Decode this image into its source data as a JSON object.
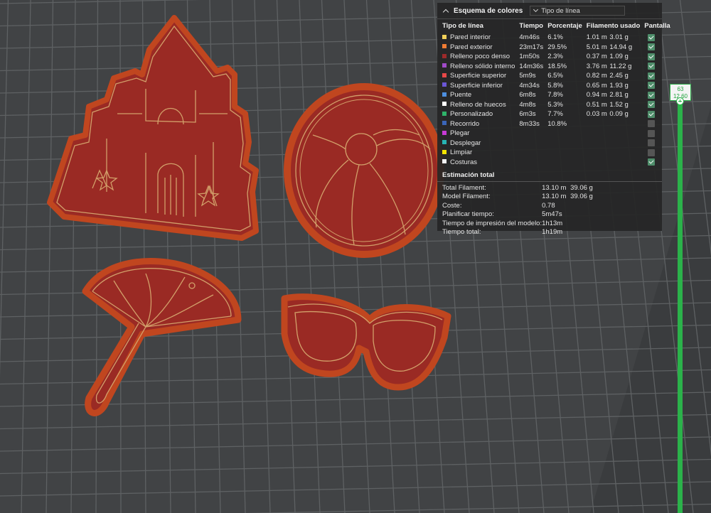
{
  "legend": {
    "title": "Esquema de colores",
    "view_mode": "Tipo de línea",
    "columns": [
      "Tipo de línea",
      "Tiempo",
      "Porcentaje",
      "Filamento usado",
      "Pantalla"
    ],
    "rows": [
      {
        "name": "Pared interior",
        "color": "#f2d15a",
        "time": "4m46s",
        "pct": "6.1%",
        "length": "1.01 m",
        "weight": "3.01 g",
        "display": true
      },
      {
        "name": "Pared exterior",
        "color": "#f07c34",
        "time": "23m17s",
        "pct": "29.5%",
        "length": "5.01 m",
        "weight": "14.94 g",
        "display": true
      },
      {
        "name": "Relleno poco denso",
        "color": "#9c2a2a",
        "time": "1m50s",
        "pct": "2.3%",
        "length": "0.37 m",
        "weight": "1.09 g",
        "display": true
      },
      {
        "name": "Relleno sólido interno",
        "color": "#a14bc9",
        "time": "14m36s",
        "pct": "18.5%",
        "length": "3.76 m",
        "weight": "11.22 g",
        "display": true
      },
      {
        "name": "Superficie superior",
        "color": "#e84848",
        "time": "5m9s",
        "pct": "6.5%",
        "length": "0.82 m",
        "weight": "2.45 g",
        "display": true
      },
      {
        "name": "Superficie inferior",
        "color": "#6b57d6",
        "time": "4m34s",
        "pct": "5.8%",
        "length": "0.65 m",
        "weight": "1.93 g",
        "display": true
      },
      {
        "name": "Puente",
        "color": "#4d8fe0",
        "time": "6m8s",
        "pct": "7.8%",
        "length": "0.94 m",
        "weight": "2.81 g",
        "display": true
      },
      {
        "name": "Relleno de huecos",
        "color": "#ffffff",
        "time": "4m8s",
        "pct": "5.3%",
        "length": "0.51 m",
        "weight": "1.52 g",
        "display": true
      },
      {
        "name": "Personalizado",
        "color": "#2fb36a",
        "time": "6m3s",
        "pct": "7.7%",
        "length": "0.03 m",
        "weight": "0.09 g",
        "display": true
      },
      {
        "name": "Recorrido",
        "color": "#3a66b8",
        "time": "8m33s",
        "pct": "10.8%",
        "length": "",
        "weight": "",
        "display": false
      },
      {
        "name": "Plegar",
        "color": "#c73ad6",
        "time": "",
        "pct": "",
        "length": "",
        "weight": "",
        "display": false
      },
      {
        "name": "Desplegar",
        "color": "#27b4b4",
        "time": "",
        "pct": "",
        "length": "",
        "weight": "",
        "display": false
      },
      {
        "name": "Limpiar",
        "color": "#f4e400",
        "time": "",
        "pct": "",
        "length": "",
        "weight": "",
        "display": false
      },
      {
        "name": "Costuras",
        "color": "#f2f2f2",
        "time": "",
        "pct": "",
        "length": "",
        "weight": "",
        "display": true
      }
    ]
  },
  "estimation": {
    "title": "Estimación total",
    "rows": [
      {
        "label": "Total Filament:",
        "value": "13.10 m",
        "value2": "39.06 g"
      },
      {
        "label": "Model Filament:",
        "value": "13.10 m",
        "value2": "39.06 g"
      },
      {
        "label": "Coste:",
        "value": "0.78",
        "value2": ""
      },
      {
        "label": "Planificar tiempo:",
        "value": "5m47s",
        "value2": ""
      },
      {
        "label": "Tiempo de impresión del modelo:",
        "value": "1h13m",
        "value2": ""
      },
      {
        "label": "Tiempo total:",
        "value": "1h19m",
        "value2": ""
      }
    ]
  },
  "slider": {
    "layer": "63",
    "height": "12.60"
  },
  "colors": {
    "plate": "#3b3d3f",
    "grid": "#5a5c5e",
    "model_fill": "#9a2a24",
    "model_rim": "#c0461f",
    "wall_line": "#d2a06a",
    "slider_green": "#2bb24a"
  }
}
